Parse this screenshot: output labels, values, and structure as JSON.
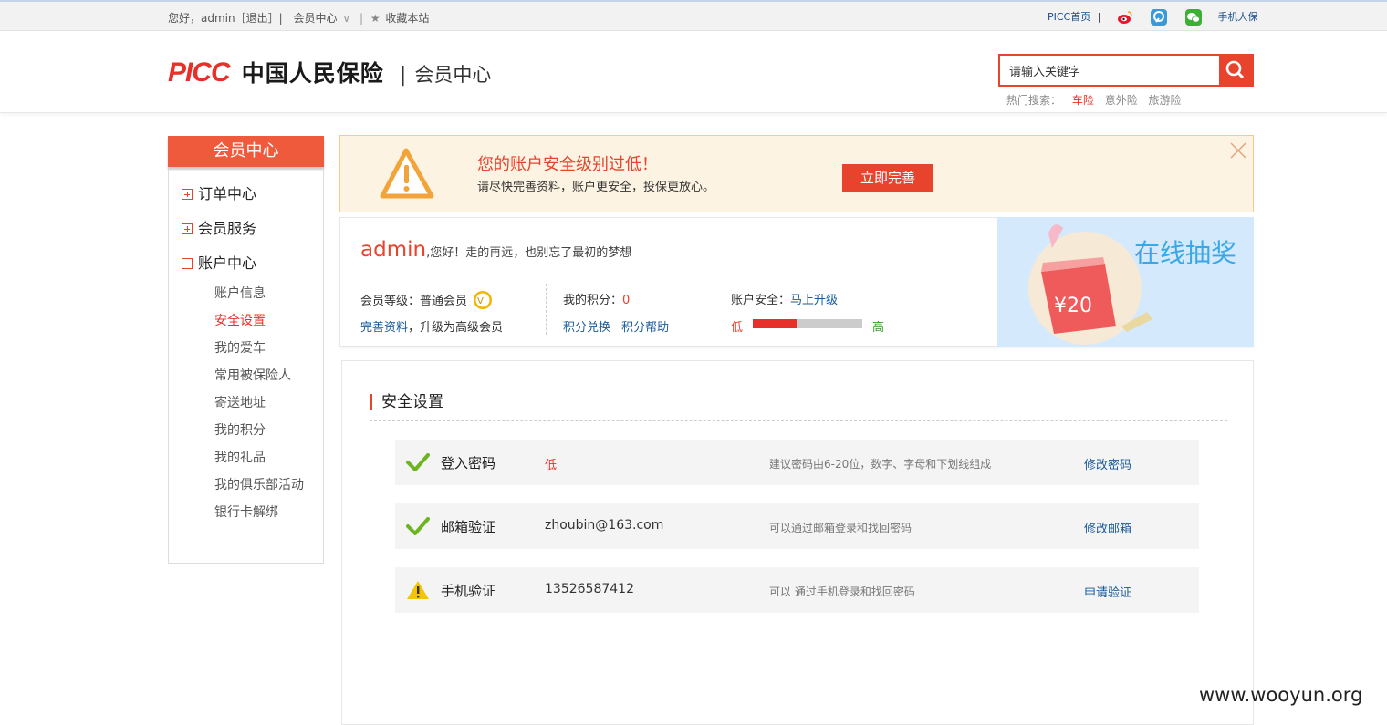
{
  "topbar": {
    "greeting": "您好，admin［退出］|",
    "member_center": "会员中心",
    "divider": "|",
    "bookmark": "收藏本站",
    "picc_home": "PICC首页",
    "mobile": "手机人保"
  },
  "header": {
    "logo_picc": "PICC",
    "logo_cn": "中国人民保险",
    "logo_sep": "|",
    "logo_sub": "会员中心",
    "search": {
      "value": "请输入关键字"
    },
    "hot_label": "热门搜索：",
    "hot_items": [
      "车险",
      "意外险",
      "旅游险"
    ]
  },
  "sidebar": {
    "title": "会员中心",
    "groups": [
      "订单中心",
      "会员服务",
      "账户中心"
    ],
    "items": [
      "账户信息",
      "安全设置",
      "我的爱车",
      "常用被保险人",
      "寄送地址",
      "我的积分",
      "我的礼品",
      "我的俱乐部活动",
      "银行卡解绑"
    ],
    "active_item": "安全设置"
  },
  "alert": {
    "headline": "您的账户安全级别过低！",
    "desc": "请尽快完善资料，账户更安全，投保更放心。",
    "button": "立即完善"
  },
  "profile": {
    "name": "admin",
    "greeting": ",您好！走的再远，也别忘了最初的梦想",
    "level_label": "会员等级：普通会员",
    "complete_link": "完善资料",
    "upgrade_text": "，升级为高级会员",
    "points_label": "我的积分：",
    "points_value": "0",
    "points_exchange": "积分兑换",
    "points_help": "积分帮助",
    "security_label": "账户安全：",
    "security_upgrade": "马上升级",
    "security_low": "低",
    "security_high": "高",
    "security_level": 0.4
  },
  "banner": {
    "title": "在线抽奖",
    "coupon": "¥20"
  },
  "security": {
    "title": "安全设置",
    "rows": [
      {
        "label": "登入密码",
        "value": "低",
        "hint": "建议密码由6-20位，数字、字母和下划线组成",
        "action": "修改密码",
        "status_icon": "check-icon"
      },
      {
        "label": "邮箱验证",
        "value": "zhoubin@163.com",
        "hint": "可以通过邮箱登录和找回密码",
        "action": "修改邮箱",
        "status_icon": "check-icon"
      },
      {
        "label": "手机验证",
        "value": "13526587412",
        "hint": "可以 通过手机登录和找回密码",
        "action": "申请验证",
        "status_icon": "warning-icon"
      }
    ]
  },
  "watermark": "www.wooyun.org",
  "colors": {
    "accent": "#e8432d",
    "link": "#1a5a9a",
    "check": "#6cb521",
    "warning": "#f5c400"
  }
}
